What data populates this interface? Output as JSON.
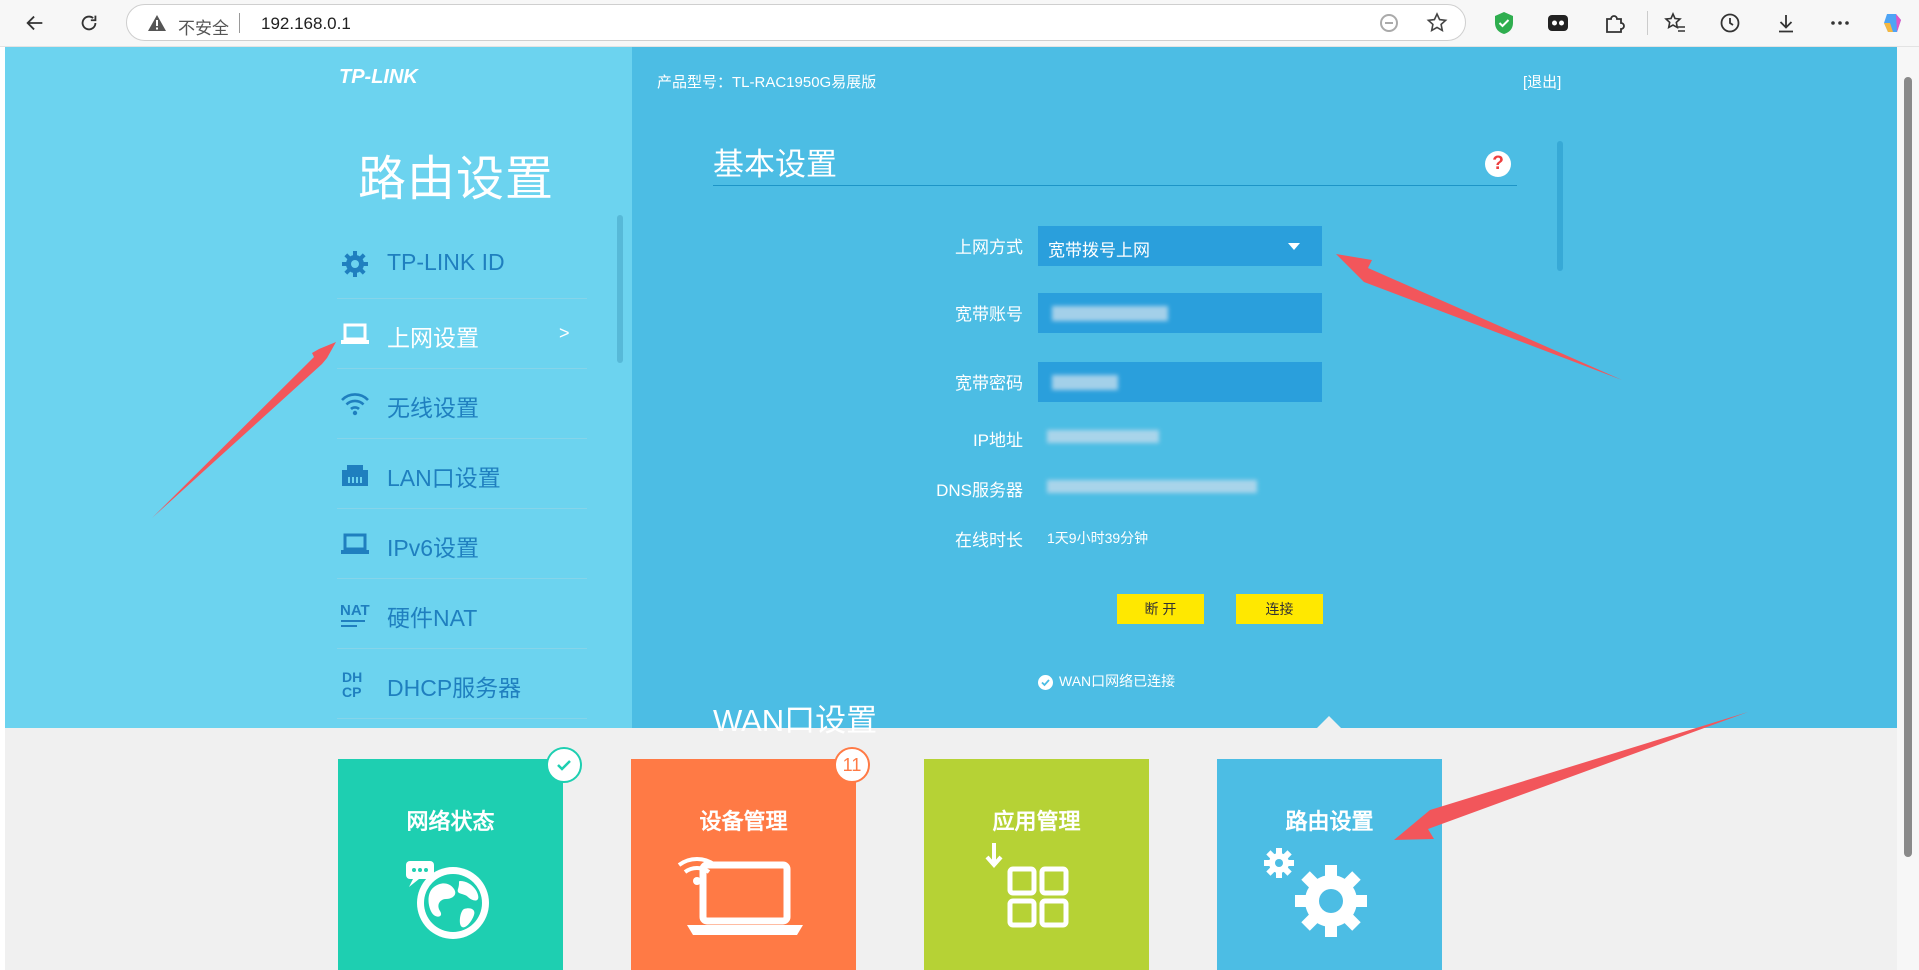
{
  "browser": {
    "security_label": "不安全",
    "url": "192.168.0.1"
  },
  "brand": {
    "logo": "TP-LINK"
  },
  "header": {
    "heading": "路由设置",
    "model": "产品型号：TL-RAC1950G易展版",
    "logout": "[退出]"
  },
  "menu": [
    {
      "label": "TP-LINK ID",
      "icon": "gear-icon"
    },
    {
      "label": "上网设置",
      "icon": "laptop-icon",
      "arrow": ">"
    },
    {
      "label": "无线设置",
      "icon": "wifi-icon"
    },
    {
      "label": "LAN口设置",
      "icon": "lan-icon"
    },
    {
      "label": "IPv6设置",
      "icon": "laptop-icon"
    },
    {
      "label": "硬件NAT",
      "icon": "nat-icon"
    },
    {
      "label": "DHCP服务器",
      "icon": "dhcp-icon"
    }
  ],
  "basic": {
    "title": "基本设置",
    "help": "?",
    "wan_type_label": "上网方式",
    "wan_type_value": "宽带拨号上网",
    "account_label": "宽带账号",
    "password_label": "宽带密码",
    "ip_label": "IP地址",
    "dns_label": "DNS服务器",
    "uptime_label": "在线时长",
    "uptime_value": "1天9小时39分钟",
    "disconnect": "断 开",
    "connect": "连接",
    "status": "WAN口网络已连接"
  },
  "wan": {
    "title": "WAN口设置"
  },
  "tiles": [
    {
      "label": "网络状态",
      "color": "#1ecfb1"
    },
    {
      "label": "设备管理",
      "color": "#ff7a45",
      "badge": "11"
    },
    {
      "label": "应用管理",
      "color": "#b6d235"
    },
    {
      "label": "路由设置",
      "color": "#4cbde4"
    }
  ],
  "colors": {
    "left_panel": "#6cd3ef",
    "right_panel": "#4cbde4",
    "field": "#2a9fdc",
    "button": "#ffe800",
    "annotation_arrow": "#f2565b"
  }
}
